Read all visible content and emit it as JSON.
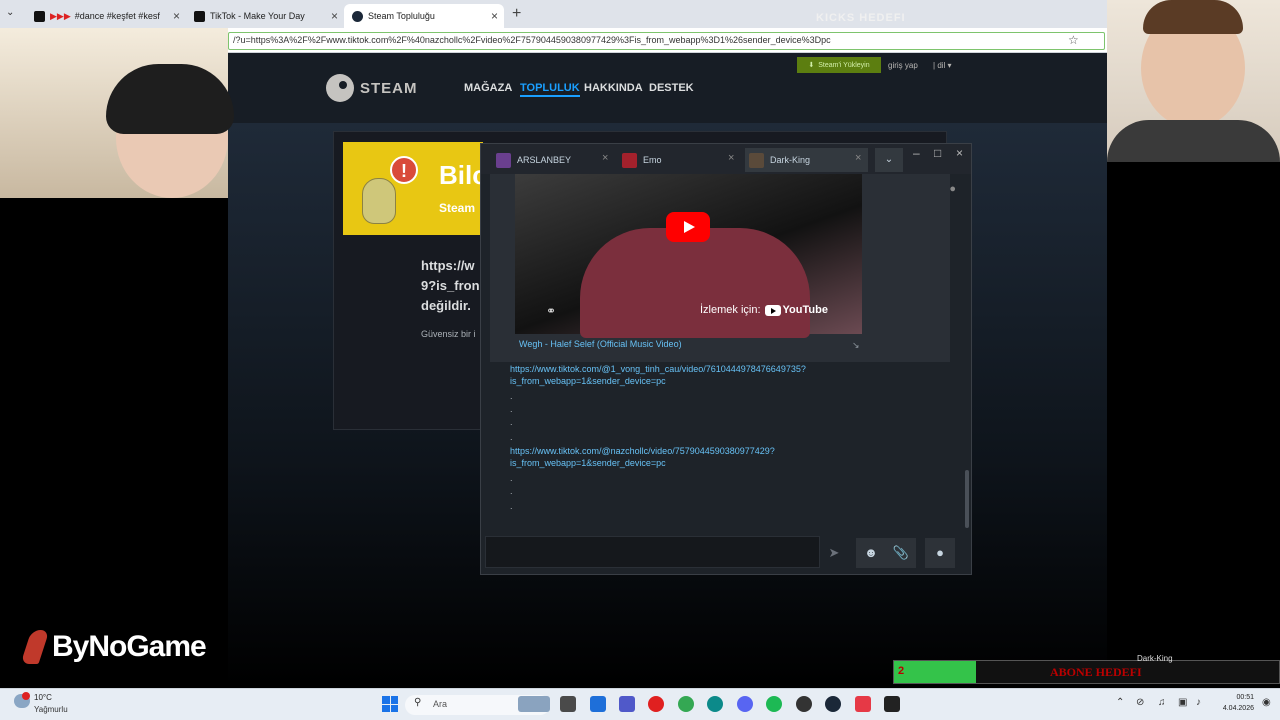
{
  "browser": {
    "tabs": [
      {
        "label": "#dance #keşfet #kesf"
      },
      {
        "label": "TikTok - Make Your Day"
      },
      {
        "label": "Steam Topluluğu"
      }
    ],
    "url": "/?u=https%3A%2F%2Fwww.tiktok.com%2F%40nazchollc%2Fvideo%2F7579044590380977429%3Fis_from_webapp%3D1%26sender_device%3Dpc"
  },
  "steam": {
    "logo_text": "STEAM",
    "nav": [
      "MAĞAZA",
      "TOPLULUK",
      "HAKKINDA",
      "DESTEK"
    ],
    "install_label": "Steam'i Yükleyin",
    "login_label": "giriş yap",
    "lang_label": "dil",
    "warning": {
      "title": "Bilc",
      "subtitle": "Steam",
      "url_line1": "https://w",
      "url_line2": "9?is_fron",
      "url_line3": "değildir.",
      "note": "Güvensiz bir i"
    }
  },
  "chat": {
    "tabs": [
      {
        "name": "ARSLANBEY",
        "color": "#6a3f8e"
      },
      {
        "name": "Emo",
        "color": "#a3212c"
      },
      {
        "name": "Dark-King",
        "color": "#5a4a3a"
      }
    ],
    "embed": {
      "watch_label": "İzlemek için:",
      "youtube_label": "YouTube",
      "title": "Wegh - Halef Selef (Official Music Video)"
    },
    "messages": [
      {
        "line1": "https://www.tiktok.com/@1_vong_tinh_cau/video/7610444978476649735?",
        "line2": "is_from_webapp=1&sender_device=pc"
      },
      {
        "line1": "https://www.tiktok.com/@nazchollc/video/7579044590380977429?",
        "line2": "is_from_webapp=1&sender_device=pc"
      }
    ],
    "dot": "."
  },
  "overlay": {
    "goal_text": "KICKS HEDEFI",
    "brand": "ByNoGame",
    "sub_count": "2",
    "sub_label": "ABONE HEDEFI",
    "dk_label": "Dark-King"
  },
  "taskbar": {
    "weather_temp": "10°C",
    "weather_desc": "Yağmurlu",
    "search_placeholder": "Ara",
    "time": "00:51",
    "date": "4.04.2026"
  }
}
